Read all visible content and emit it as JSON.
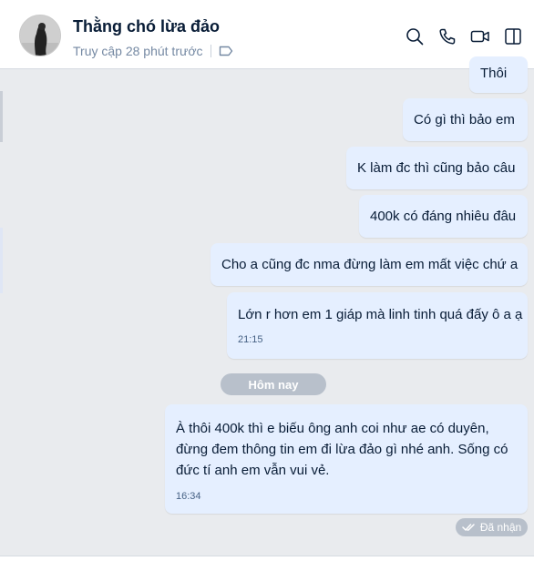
{
  "header": {
    "contact_name": "Thằng chó lừa đảo",
    "status": "Truy cập 28 phút trước",
    "icons": [
      "tag-icon",
      "search-icon",
      "phone-icon",
      "video-icon",
      "panel-toggle-icon"
    ]
  },
  "messages": [
    {
      "text": "Thôi"
    },
    {
      "text": "Có gì thì bảo em"
    },
    {
      "text": "K làm đc thì cũng bảo câu"
    },
    {
      "text": "400k có đáng nhiêu đâu"
    },
    {
      "text": "Cho a cũng đc nma đừng làm em mất việc chứ a"
    },
    {
      "text": "Lớn r hơn em 1 giáp mà linh tinh quá đấy ô a ạ",
      "time": "21:15"
    }
  ],
  "date_divider": "Hôm nay",
  "last_message": {
    "line1": "À thôi 400k thì e biếu ông anh coi như ae có duyên,",
    "line2": "đừng đem thông tin em đi lừa đảo gì nhé anh. Sống có",
    "line3": "đức tí anh em vẫn vui vẻ.",
    "time": "16:34"
  },
  "receipt_status": "Đã nhận",
  "colors": {
    "chat_background": "#e9ebee",
    "outgoing_bubble": "#e5efff",
    "divider_pill": "#b8c0cb",
    "name_text": "#081c36",
    "muted_text": "#7589a3"
  }
}
